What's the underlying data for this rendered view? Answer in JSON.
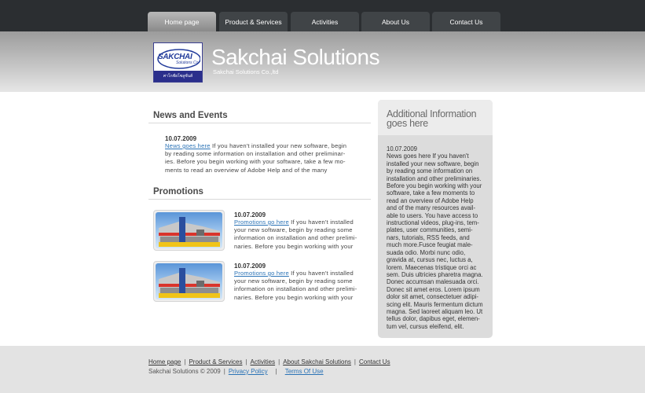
{
  "nav": {
    "tabs": [
      {
        "label": "Home page",
        "active": true
      },
      {
        "label": "Product & Services",
        "active": false
      },
      {
        "label": "Activities",
        "active": false
      },
      {
        "label": "About Us",
        "active": false
      },
      {
        "label": "Contact Us",
        "active": false
      }
    ]
  },
  "header": {
    "logo_word": "SAKCHAI",
    "logo_sub": "Solutions Co",
    "logo_thai": "ศาโกฟ์ยโซลูชั่นส์",
    "title": "Sakchai Solutions",
    "subtitle": "Sakchai Solutions Co.,ltd"
  },
  "news": {
    "heading": "News and Events",
    "date": "10.07.2009",
    "link": "News goes here",
    "body_lines": [
      " If you haven't installed your new software, begin",
      "by reading some information on installation and other preliminar-",
      "ies. Before you begin working with your software, take a few mo-",
      "ments to read an overview of Adobe Help and of the many"
    ]
  },
  "promotions": {
    "heading": "Promotions",
    "items": [
      {
        "date": "10.07.2009",
        "link": "Promotions go here",
        "body_lines": [
          " If you haven't installed",
          "your new software, begin by reading some",
          "information on installation and other prelimi-",
          "naries. Before you begin working with your"
        ]
      },
      {
        "date": "10.07.2009",
        "link": "Promotions go here",
        "body_lines": [
          " If you haven't installed",
          "your new software, begin by reading some",
          "information on installation and other prelimi-",
          "naries. Before you begin working with your"
        ]
      }
    ]
  },
  "sidebar": {
    "title_line1": "Additional Information",
    "title_line2": "goes here",
    "body_lines": [
      "10.07.2009",
      "News goes here If you haven't",
      "installed your new software, begin",
      "by reading some information on",
      "installation and other preliminaries.",
      "Before you begin working with your",
      "software, take a few moments to",
      "read an overview of Adobe Help",
      "and of the many resources avail-",
      "able to users. You have access to",
      "instructional videos, plug-ins, tem-",
      "plates, user communities, semi-",
      "nars, tutorials, RSS feeds, and",
      "much more.Fusce feugiat male-",
      "suada odio. Morbi nunc odio,",
      "gravida at, cursus nec, luctus a,",
      "lorem. Maecenas tristique orci ac",
      "sem. Duis ultricies pharetra magna.",
      "Donec accumsan malesuada orci.",
      "Donec sit amet eros. Lorem ipsum",
      "dolor sit amet, consectetuer adipi-",
      "scing elit. Mauris fermentum dictum",
      "magna. Sed laoreet aliquam leo. Ut",
      "tellus dolor, dapibus eget, elemen-",
      "tum vel, cursus eleifend, elit."
    ]
  },
  "footer": {
    "links": [
      "Home page",
      "Product & Services",
      "Activities",
      "About Sakchai Solutions",
      "Contact Us"
    ],
    "separator": "|",
    "copyright": "Sakchai Solutions © 2009",
    "privacy": "Privacy Policy",
    "terms": "Terms Of Use"
  }
}
